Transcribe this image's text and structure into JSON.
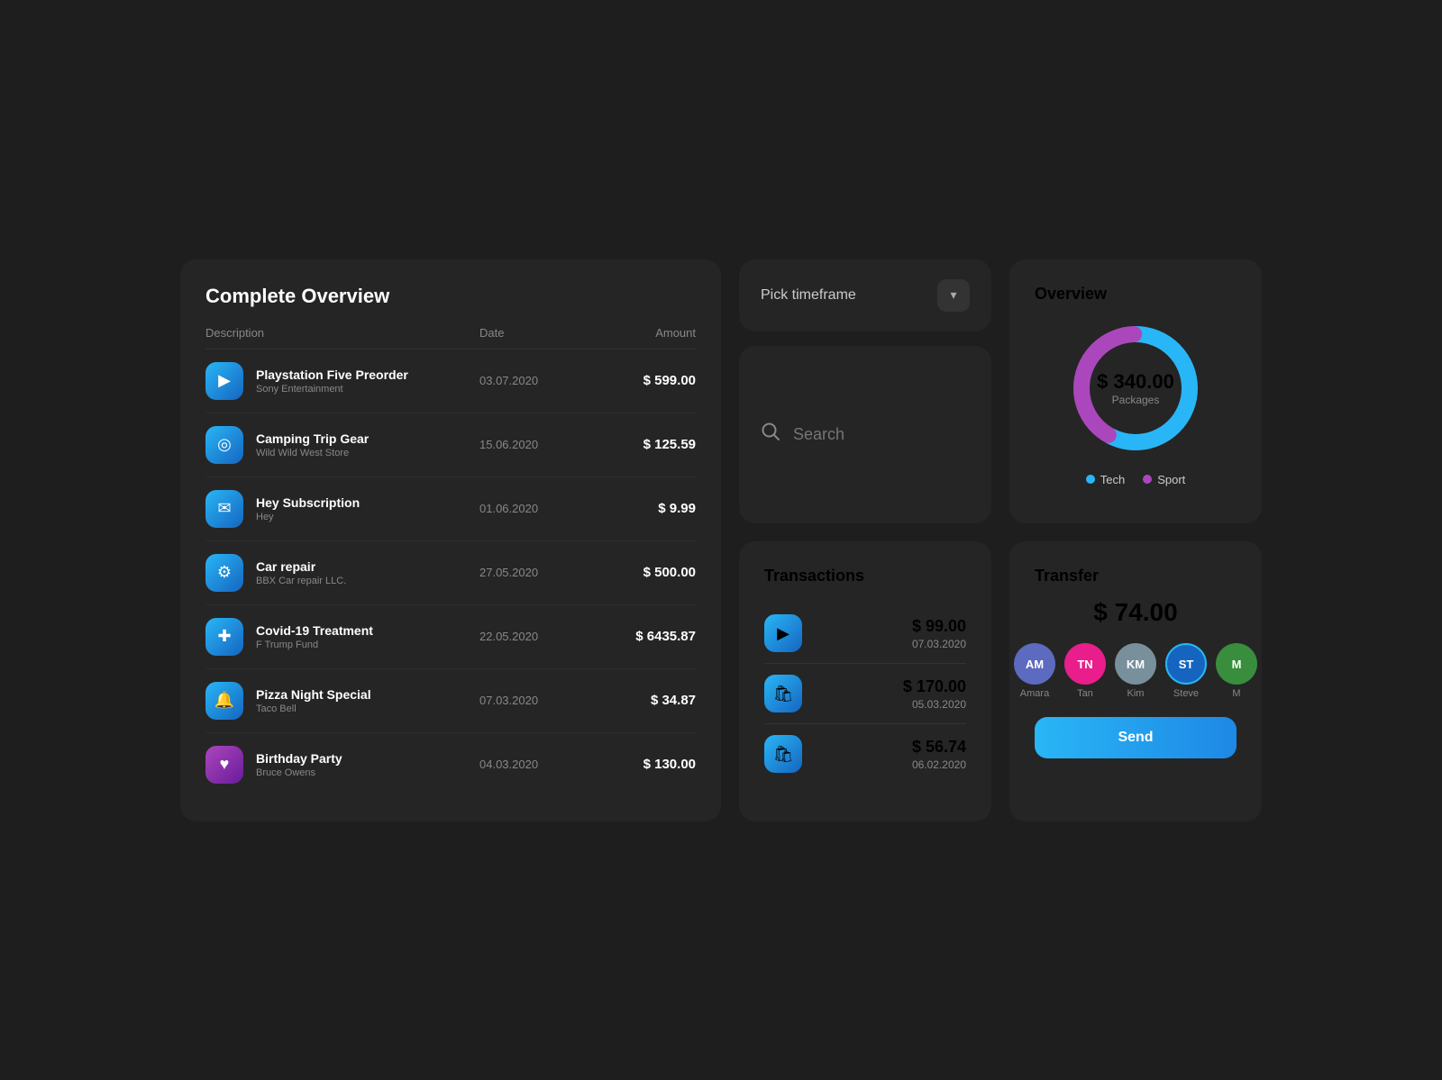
{
  "overview": {
    "title": "Complete Overview",
    "table_header": {
      "description": "Description",
      "date": "Date",
      "amount": "Amount"
    },
    "rows": [
      {
        "icon": "🎮",
        "icon_type": "blue",
        "title": "Playstation Five Preorder",
        "subtitle": "Sony Entertainment",
        "date": "03.07.2020",
        "amount": "$ 599.00"
      },
      {
        "icon": "🧭",
        "icon_type": "blue",
        "title": "Camping Trip Gear",
        "subtitle": "Wild Wild West Store",
        "date": "15.06.2020",
        "amount": "$ 125.59"
      },
      {
        "icon": "✉️",
        "icon_type": "blue",
        "title": "Hey Subscription",
        "subtitle": "Hey",
        "date": "01.06.2020",
        "amount": "$ 9.99"
      },
      {
        "icon": "⚙️",
        "icon_type": "blue",
        "title": "Car repair",
        "subtitle": "BBX Car repair LLC.",
        "date": "27.05.2020",
        "amount": "$ 500.00"
      },
      {
        "icon": "➕",
        "icon_type": "blue",
        "title": "Covid-19 Treatment",
        "subtitle": "F Trump Fund",
        "date": "22.05.2020",
        "amount": "$ 6435.87"
      },
      {
        "icon": "🔔",
        "icon_type": "blue",
        "title": "Pizza Night Special",
        "subtitle": "Taco Bell",
        "date": "07.03.2020",
        "amount": "$ 34.87"
      },
      {
        "icon": "♥",
        "icon_type": "purple",
        "title": "Birthday Party",
        "subtitle": "Bruce Owens",
        "date": "04.03.2020",
        "amount": "$ 130.00"
      }
    ]
  },
  "timeframe": {
    "label": "Pick timeframe",
    "button_icon": "▾"
  },
  "search": {
    "placeholder": "Search"
  },
  "donut_chart": {
    "title": "Overview",
    "amount": "$ 340.00",
    "label": "Packages",
    "tech_pct": 58,
    "sport_pct": 42,
    "legend": {
      "tech": "Tech",
      "sport": "Sport"
    }
  },
  "transactions": {
    "title": "Transactions",
    "items": [
      {
        "icon": "🎮",
        "amount": "$ 99.00",
        "date": "07.03.2020"
      },
      {
        "icon": "🛍",
        "amount": "$ 170.00",
        "date": "05.03.2020"
      },
      {
        "icon": "🛍",
        "amount": "$ 56.74",
        "date": "06.02.2020"
      }
    ]
  },
  "transfer": {
    "title": "Transfer",
    "amount": "$ 74.00",
    "contacts": [
      {
        "name": "Amara",
        "color": "#5c6bc0",
        "initials": "AM"
      },
      {
        "name": "Tan",
        "color": "#e91e8c",
        "initials": "TN"
      },
      {
        "name": "Kim",
        "color": "#78909c",
        "initials": "KM"
      },
      {
        "name": "Steve",
        "color": "#1565c0",
        "initials": "ST",
        "active": true
      },
      {
        "name": "M",
        "color": "#388e3c",
        "initials": "M"
      }
    ],
    "send_label": "Send"
  }
}
